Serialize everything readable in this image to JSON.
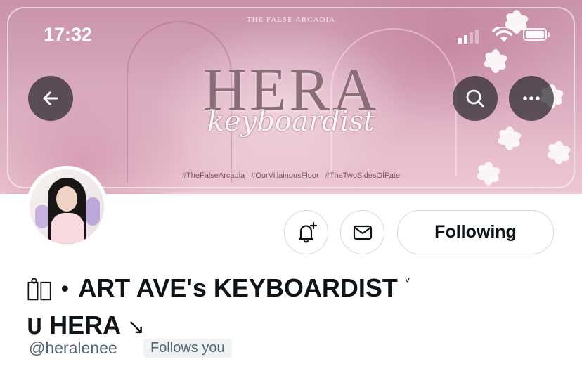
{
  "status_bar": {
    "time": "17:32"
  },
  "banner": {
    "top_label": "THE FALSE ARCADIA",
    "title": "HERA",
    "subtitle": "keyboardist",
    "hashtags": "#TheFalseArcadia #OurVillainousFloor #TheTwoSidesOfFate"
  },
  "nav": {
    "back_icon": "arrow-left-icon",
    "search_icon": "search-icon",
    "more_icon": "more-horizontal-icon"
  },
  "actions": {
    "notify_icon": "bell-plus-icon",
    "message_icon": "envelope-icon",
    "following_label": "Following"
  },
  "profile": {
    "name_prefix": "ဏ̊ၢ •",
    "name_main": "ART AVE's KEYBOARDIST",
    "name_suffix": "ᵛ",
    "name_line2_prefix": "𝐔",
    "name_line2_main": "HERA",
    "name_line2_suffix": "↘",
    "handle": "@heralenee",
    "follows_badge": "Follows you"
  },
  "colors": {
    "text_primary": "#0f1419",
    "text_secondary": "#536471",
    "border": "#cfd9de",
    "nav_button_bg": "#28282e"
  }
}
